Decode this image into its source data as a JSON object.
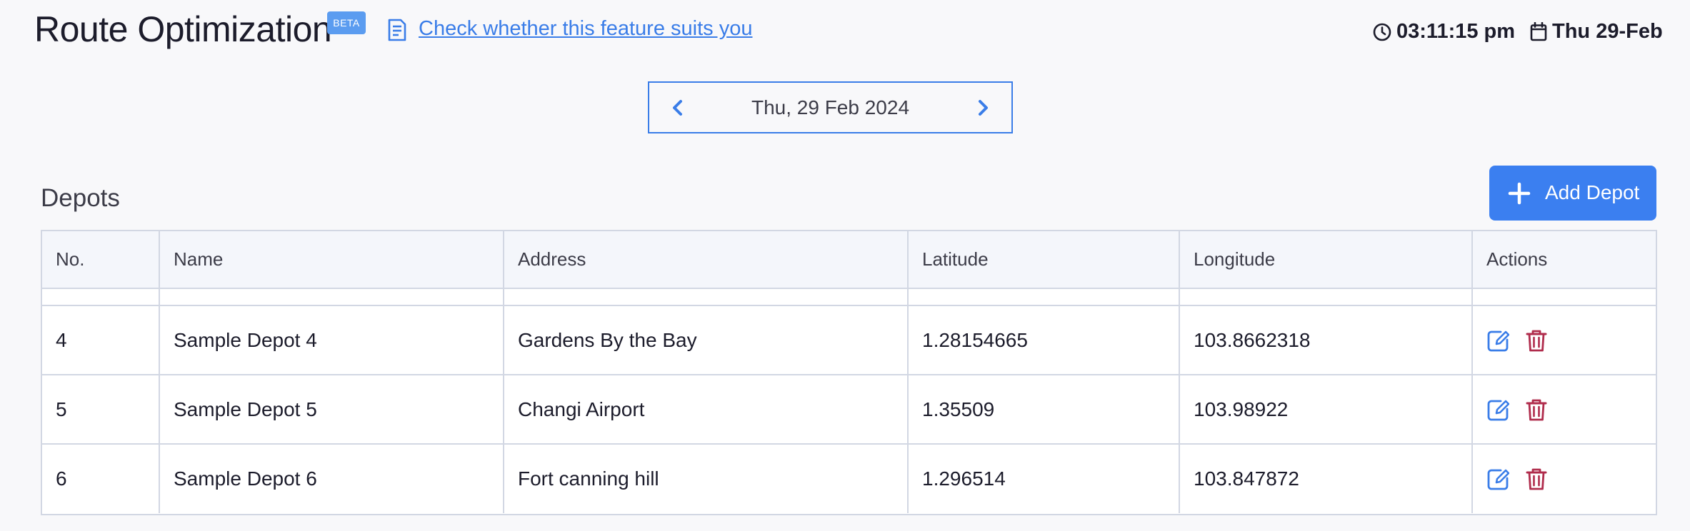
{
  "header": {
    "title": "Route Optimization",
    "badge": "BETA",
    "feature_link": "Check whether this feature suits you",
    "time": "03:11:15 pm",
    "date": "Thu 29-Feb"
  },
  "date_nav": {
    "label": "Thu, 29 Feb 2024"
  },
  "depots": {
    "title": "Depots",
    "add_button_label": "Add Depot",
    "columns": [
      "No.",
      "Name",
      "Address",
      "Latitude",
      "Longitude",
      "Actions"
    ],
    "rows": [
      {
        "no": "4",
        "name": "Sample Depot 4",
        "address": "Gardens By the Bay",
        "latitude": "1.28154665",
        "longitude": "103.8662318"
      },
      {
        "no": "5",
        "name": "Sample Depot 5",
        "address": "Changi Airport",
        "latitude": "1.35509",
        "longitude": "103.98922"
      },
      {
        "no": "6",
        "name": "Sample Depot 6",
        "address": "Fort canning hill",
        "latitude": "1.296514",
        "longitude": "103.847872"
      }
    ]
  },
  "icons": {
    "document": "document-icon",
    "clock": "clock-icon",
    "calendar": "calendar-icon",
    "prev": "chevron-left-icon",
    "next": "chevron-right-icon",
    "plus": "plus-icon",
    "edit": "edit-icon",
    "delete": "trash-icon"
  },
  "colors": {
    "accent": "#3b7ff0",
    "link": "#3a7de8",
    "badge": "#5b9cf0",
    "delete": "#b02c4c",
    "background": "#f8f8fa"
  }
}
